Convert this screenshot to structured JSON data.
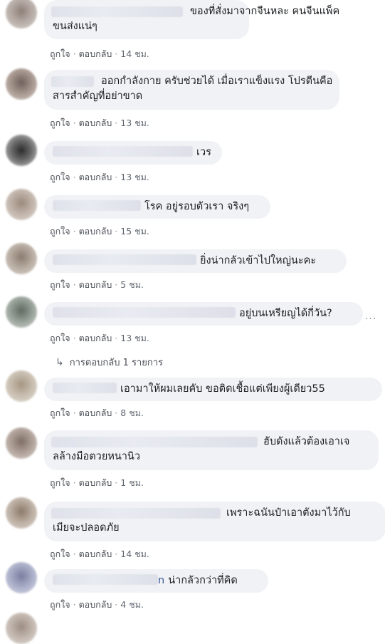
{
  "comments": [
    {
      "text": "ของที่สั่งมาจากจีนหละ คนจีนแพ็ค",
      "text2": "ขนส่งแน่ๆ",
      "like": "ถูกใจ",
      "reply": "ตอบกลับ",
      "time": "14 ชม."
    },
    {
      "text": "ออกกำลังกาย ครับช่วยได้ เมื่อเราแข็งแรง โปรตีนคือ",
      "text2": "สารสำคัญที่อย่าขาด",
      "like": "ถูกใจ",
      "reply": "ตอบกลับ",
      "time": "13 ชม."
    },
    {
      "text": "เวร",
      "like": "ถูกใจ",
      "reply": "ตอบกลับ",
      "time": "13 ชม."
    },
    {
      "text": "โรค อยู่รอบตัวเรา จริงๆ",
      "like": "ถูกใจ",
      "reply": "ตอบกลับ",
      "time": "15 ชม."
    },
    {
      "text": "ยิ่งน่ากลัวเข้าไปใหญ่นะคะ",
      "like": "ถูกใจ",
      "reply": "ตอบกลับ",
      "time": "5 ชม."
    },
    {
      "text": "อยู่บนเหรียญได้กี่วัน?",
      "like": "ถูกใจ",
      "reply": "ตอบกลับ",
      "time": "13 ชม."
    },
    {
      "text": "เอามาให้ผมเลยคับ ขอติดเชื้อแต่เพียงผู้เดียว55",
      "like": "ถูกใจ",
      "reply": "ตอบกลับ",
      "time": "8 ชม."
    },
    {
      "text": "ฮับดังแล้วต้องเอาเจ",
      "text2": "ลล้างมือตวยหนานิว",
      "like": "ถูกใจ",
      "reply": "ตอบกลับ",
      "time": "1 ชม."
    },
    {
      "text": "เพราะฉนันป๋าเอาตังมาไว้กับ",
      "text2": "เมียจะปลอดภัย",
      "like": "ถูกใจ",
      "reply": "ตอบกลับ",
      "time": "14 ชม."
    },
    {
      "text": "น่ากลัวกว่าที่คิด",
      "name_tail": "n",
      "like": "ถูกใจ",
      "reply": "ตอบกลับ",
      "time": "4 ชม."
    }
  ],
  "reply_thread": {
    "label": "การตอบกลับ 1 รายการ"
  },
  "more_options": "···",
  "colors": {
    "bubble": "#f1f2f5",
    "text": "#1c1e21",
    "meta": "#606770"
  }
}
